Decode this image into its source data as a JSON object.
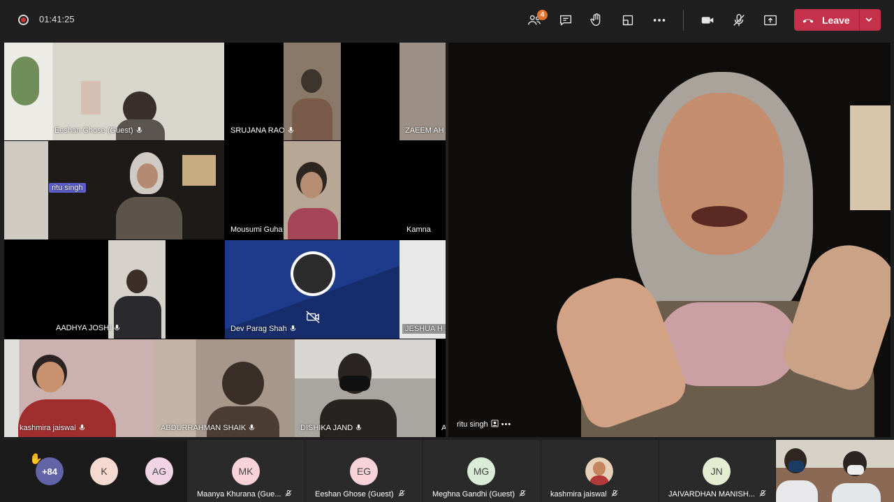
{
  "toolbar": {
    "timer": "01:41:25",
    "participants_badge": "4",
    "leave_label": "Leave"
  },
  "gallery": [
    {
      "name": "Eeshan Ghose (Guest)",
      "bg": "#cfd3c8"
    },
    {
      "name": "SRUJANA RAO",
      "bg": "#8f7a66"
    },
    {
      "name": "ZAEEM AH",
      "bg": "#9b8f86"
    },
    {
      "name": "ritu singh",
      "bg": "#2a2622"
    },
    {
      "name": "Mousumi Guha",
      "bg": "#b9a795"
    },
    {
      "name": "Kamna",
      "bg": "#000000"
    },
    {
      "name": "AADHYA JOSHI",
      "bg": "#d6d2cb"
    },
    {
      "name": "Dev Parag Shah",
      "bg": "#1e3a8a"
    },
    {
      "name": "JESHUA H",
      "bg": "#e8e8e8"
    },
    {
      "name": "kashmira jaiswal",
      "bg": "#c7a4a4"
    },
    {
      "name": "ABDURRAHMAN SHAIK",
      "bg": "#9a8878"
    },
    {
      "name": "DISHIKA JAND",
      "bg": "#b5b1ad"
    },
    {
      "name": "A",
      "bg": "#333333"
    }
  ],
  "featured": {
    "name": "ritu singh"
  },
  "strip": {
    "more_count": "+84",
    "avatars": [
      {
        "initials": "K",
        "color": "#f6d9cf",
        "name": ""
      },
      {
        "initials": "AG",
        "color": "#f0d4e4",
        "name": ""
      },
      {
        "initials": "MK",
        "color": "#f7d2d8",
        "name": "Maanya Khurana (Gue..."
      },
      {
        "initials": "EG",
        "color": "#f7d2d8",
        "name": "Eeshan Ghose (Guest)"
      },
      {
        "initials": "MG",
        "color": "#d9ecd6",
        "name": "Meghna Gandhi (Guest)"
      },
      {
        "initials": "",
        "color": "#c98a5a",
        "name": "kashmira jaiswal"
      },
      {
        "initials": "JN",
        "color": "#e4ecd2",
        "name": "JAIVARDHAN MANISH..."
      }
    ]
  }
}
